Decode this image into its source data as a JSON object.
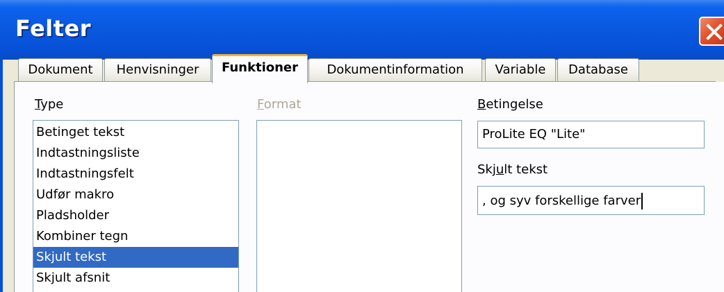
{
  "window": {
    "title": "Felter",
    "close_icon": "close-icon"
  },
  "tabs": [
    {
      "label": "Dokument",
      "active": false
    },
    {
      "label": "Henvisninger",
      "active": false
    },
    {
      "label": "Funktioner",
      "active": true
    },
    {
      "label": "Dokumentinformation",
      "active": false
    },
    {
      "label": "Variable",
      "active": false
    },
    {
      "label": "Database",
      "active": false
    }
  ],
  "type_section": {
    "label_mnemonic": "T",
    "label_rest": "ype",
    "items": [
      "Betinget tekst",
      "Indtastningsliste",
      "Indtastningsfelt",
      "Udfør makro",
      "Pladsholder",
      "Kombiner tegn",
      "Skjult tekst",
      "Skjult afsnit"
    ],
    "selected": "Skjult tekst"
  },
  "format_section": {
    "label_mnemonic": "F",
    "label_rest": "ormat",
    "disabled": true
  },
  "condition": {
    "label_mnemonic": "B",
    "label_rest": "etingelse",
    "value": "ProLite EQ \"Lite\""
  },
  "hidden_text": {
    "label_before": "Skj",
    "label_mnemonic": "u",
    "label_after": "lt tekst",
    "value": ", og syv forskellige farver"
  },
  "colors": {
    "titlebar": "#0650d6",
    "dialog_bg": "#ece9d8",
    "selection": "#316ac5",
    "active_tab_accent": "#f4b033",
    "close_button": "#e2522e"
  }
}
